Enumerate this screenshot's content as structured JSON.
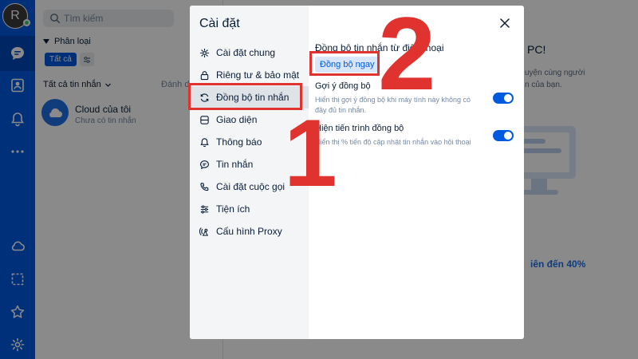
{
  "profile": {
    "initial": "R"
  },
  "search": {
    "placeholder": "Tìm kiếm"
  },
  "filters": {
    "label": "Phân loại",
    "all_chip": "Tất cả"
  },
  "list": {
    "header": "Tất cả tin nhắn",
    "header_right": "Đánh dấu",
    "conversations": [
      {
        "name": "Cloud của tôi",
        "subtitle": "Chưa có tin nhắn"
      }
    ]
  },
  "welcome": {
    "title": "PC!",
    "desc_line1": "uyện cùng người",
    "desc_line2": "n của bạn.",
    "promo": "iên đến 40%"
  },
  "dialog": {
    "title": "Cài đặt",
    "menu": [
      {
        "label": "Cài đặt chung",
        "icon": "gear-icon"
      },
      {
        "label": "Riêng tư & bảo mật",
        "icon": "lock-icon"
      },
      {
        "label": "Đồng bộ tin nhắn",
        "icon": "sync-icon",
        "active": true
      },
      {
        "label": "Giao diện",
        "icon": "palette-icon"
      },
      {
        "label": "Thông báo",
        "icon": "bell-icon"
      },
      {
        "label": "Tin nhắn",
        "icon": "message-icon"
      },
      {
        "label": "Cài đặt cuộc gọi",
        "icon": "phone-icon"
      },
      {
        "label": "Tiện ích",
        "icon": "sliders-icon"
      },
      {
        "label": "Cấu hình Proxy",
        "icon": "satellite-icon"
      }
    ],
    "section_title": "Đồng bộ tin nhắn từ điện thoại",
    "sync_button": "Đồng bộ ngay",
    "options": [
      {
        "title": "Gợi ý đồng bộ",
        "desc": "Hiển thị gợi ý đồng bộ khi máy tính này không có đầy đủ tin nhắn.",
        "enabled": true
      },
      {
        "title": "Hiện tiến trình đồng bộ",
        "desc": "Hiển thị % tiến độ cập nhật tin nhắn vào hội thoại",
        "enabled": true
      }
    ]
  },
  "annotations": {
    "step1": "1",
    "step2": "2"
  },
  "colors": {
    "brand": "#005ae0",
    "highlight": "#e0322f"
  }
}
